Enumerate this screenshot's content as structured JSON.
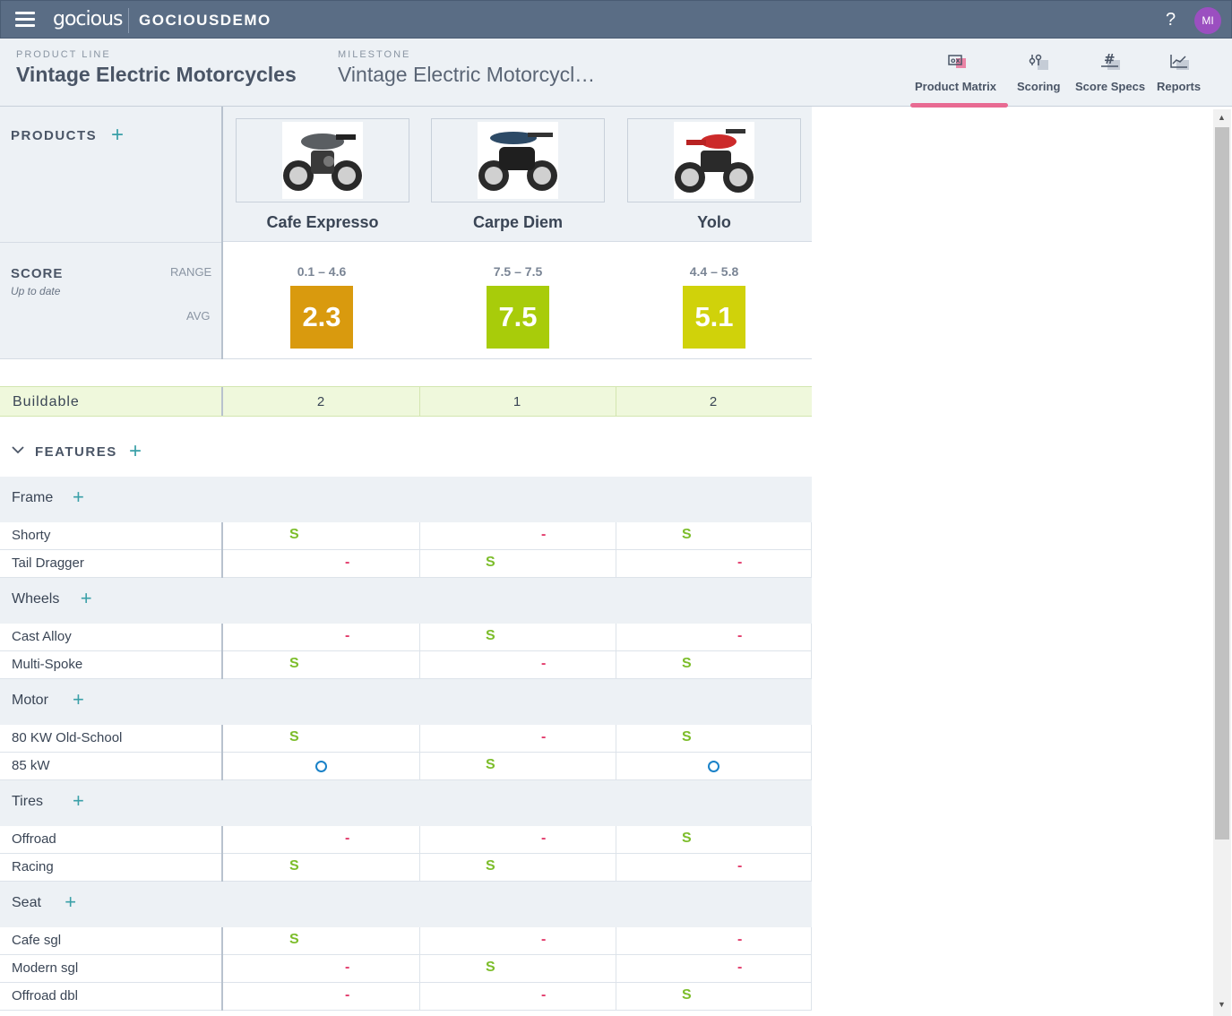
{
  "app": {
    "logo": "gocious",
    "company": "GOCIOUSDEMO",
    "help": "?",
    "avatar_initials": "MI",
    "avatar_color": "#9b4fc0"
  },
  "header": {
    "product_line_label": "PRODUCT LINE",
    "product_line_value": "Vintage Electric Motorcycles",
    "milestone_label": "MILESTONE",
    "milestone_value": "Vintage Electric Motorcycl…",
    "nav": [
      {
        "label": "Product Matrix",
        "icon": "matrix-icon",
        "active": true
      },
      {
        "label": "Scoring",
        "icon": "sliders-icon",
        "active": false
      },
      {
        "label": "Score Specs",
        "icon": "hash-icon",
        "active": false
      },
      {
        "label": "Reports",
        "icon": "chart-icon",
        "active": false
      }
    ],
    "accent_color": "#e86a92"
  },
  "products": {
    "title": "PRODUCTS",
    "items": [
      {
        "name": "Cafe Expresso",
        "range": "0.1 – 4.6",
        "avg": "2.3",
        "avg_color": "#d99a0e",
        "buildable": "2"
      },
      {
        "name": "Carpe Diem",
        "range": "7.5 – 7.5",
        "avg": "7.5",
        "avg_color": "#a8cc0a",
        "buildable": "1"
      },
      {
        "name": "Yolo",
        "range": "4.4 – 5.8",
        "avg": "5.1",
        "avg_color": "#d0d20a",
        "buildable": "2"
      }
    ]
  },
  "score": {
    "title": "SCORE",
    "status": "Up to date",
    "range_label": "RANGE",
    "avg_label": "AVG"
  },
  "buildable": {
    "label": "Buildable"
  },
  "features": {
    "title": "FEATURES",
    "categories": [
      {
        "name": "Frame",
        "rows": [
          {
            "name": "Shorty",
            "values": [
              "S",
              "-",
              "S"
            ]
          },
          {
            "name": "Tail Dragger",
            "values": [
              "-",
              "S",
              "-"
            ]
          }
        ]
      },
      {
        "name": "Wheels",
        "rows": [
          {
            "name": "Cast Alloy",
            "values": [
              "-",
              "S",
              "-"
            ]
          },
          {
            "name": "Multi-Spoke",
            "values": [
              "S",
              "-",
              "S"
            ]
          }
        ]
      },
      {
        "name": "Motor",
        "rows": [
          {
            "name": "80 KW Old-School",
            "values": [
              "S",
              "-",
              "S"
            ]
          },
          {
            "name": "85 kW",
            "values": [
              "O",
              "S",
              "O"
            ]
          }
        ]
      },
      {
        "name": "Tires",
        "rows": [
          {
            "name": "Offroad",
            "values": [
              "-",
              "-",
              "S"
            ]
          },
          {
            "name": "Racing",
            "values": [
              "S",
              "S",
              "-"
            ]
          }
        ]
      },
      {
        "name": "Seat",
        "rows": [
          {
            "name": "Cafe sgl",
            "values": [
              "S",
              "-",
              "-"
            ]
          },
          {
            "name": "Modern sgl",
            "values": [
              "-",
              "S",
              "-"
            ]
          },
          {
            "name": "Offroad dbl",
            "values": [
              "-",
              "-",
              "S"
            ]
          }
        ]
      }
    ]
  }
}
